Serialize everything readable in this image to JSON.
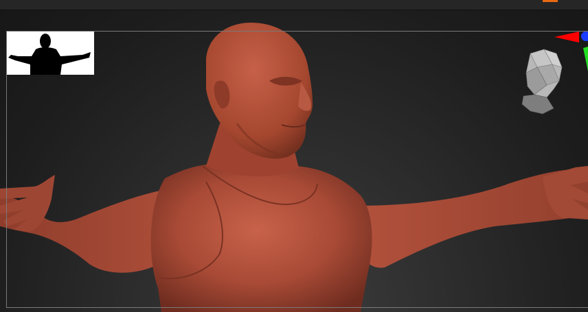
{
  "app": {
    "accent_color": "#e86a12"
  },
  "viewport": {
    "background_color": "#262626",
    "frame_color": "#7a7a7a",
    "model_material_color": "#b4503c"
  },
  "thumbnail": {
    "icon": "silhouette-thumbnail",
    "background": "#ffffff",
    "figure_color": "#000000"
  },
  "navigation": {
    "icon": "head-navigation-icon"
  },
  "axis_gizmo": {
    "x_color": "#ff0000",
    "y_color": "#22dd22",
    "z_color": "#1a3cff"
  }
}
